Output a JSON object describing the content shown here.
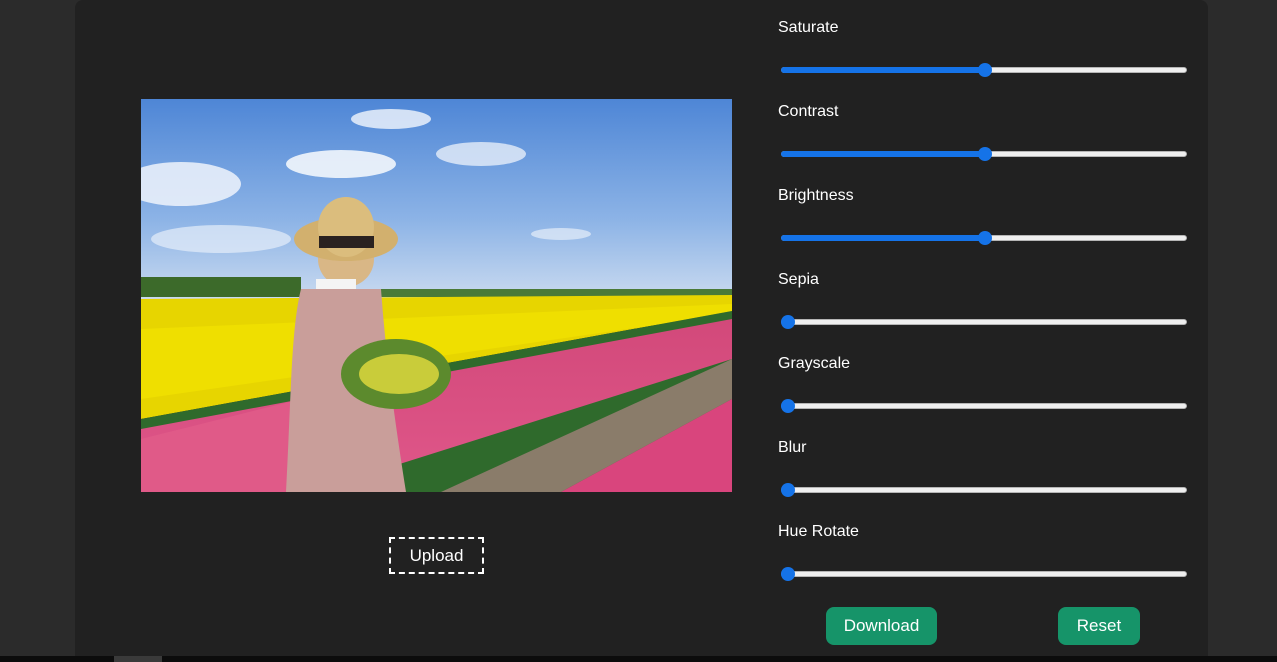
{
  "photo": {
    "alt": "Woman in straw hat holding tulips in a tulip field"
  },
  "upload": {
    "label": "Upload"
  },
  "controls": [
    {
      "label": "Saturate",
      "value": 0.5,
      "filled": true
    },
    {
      "label": "Contrast",
      "value": 0.5,
      "filled": true
    },
    {
      "label": "Brightness",
      "value": 0.5,
      "filled": true
    },
    {
      "label": "Sepia",
      "value": 0.0,
      "filled": false
    },
    {
      "label": "Grayscale",
      "value": 0.0,
      "filled": false
    },
    {
      "label": "Blur",
      "value": 0.0,
      "filled": false
    },
    {
      "label": "Hue Rotate",
      "value": 0.0,
      "filled": false
    }
  ],
  "actions": {
    "download_label": "Download",
    "reset_label": "Reset"
  },
  "colors": {
    "accent": "#1573e8",
    "button": "#169469",
    "panel": "#212121"
  }
}
